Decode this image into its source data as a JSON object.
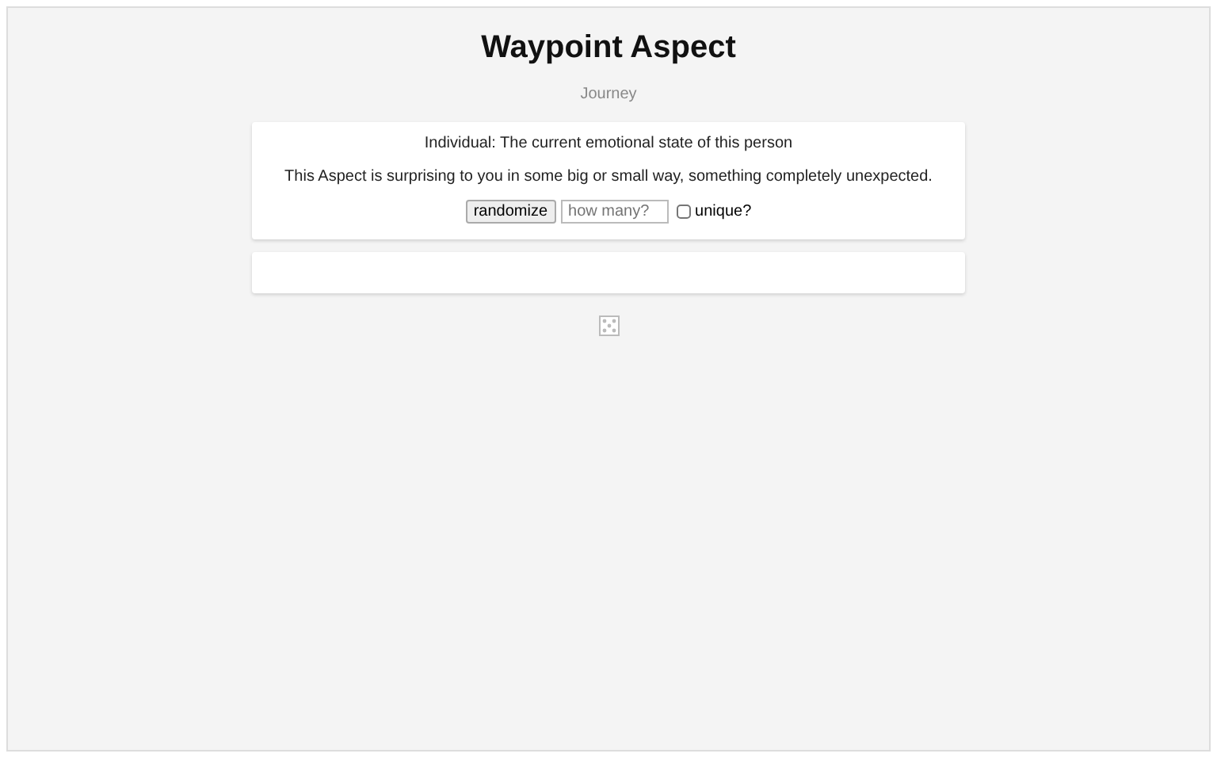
{
  "title": "Waypoint Aspect",
  "subtitle": "Journey",
  "card": {
    "heading": "Individual: The current emotional state of this person",
    "description": "This Aspect is surprising to you in some big or small way, something completely unexpected."
  },
  "controls": {
    "button": "randomize",
    "count_placeholder": "how many?",
    "unique": {
      "label": "unique?",
      "checked": false
    }
  }
}
